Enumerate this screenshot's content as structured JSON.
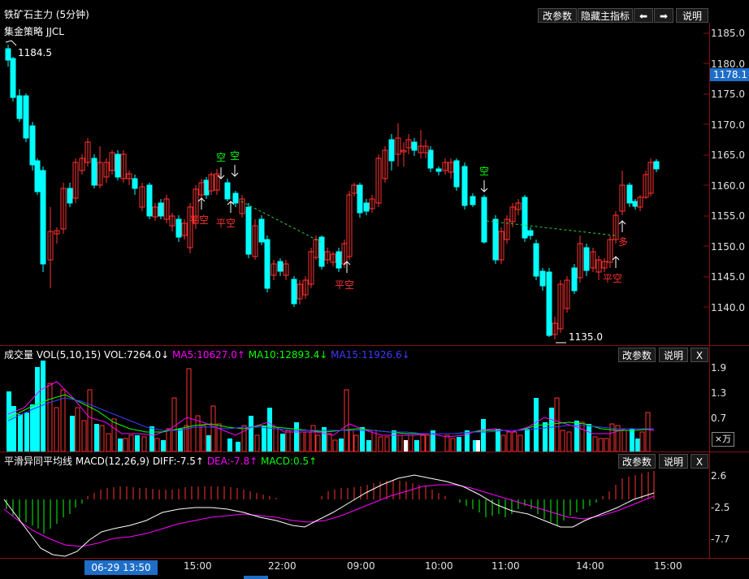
{
  "main_panel": {
    "title": "铁矿石主力 (5分钟)",
    "strategy": "集金策略 JJCL",
    "buttons": {
      "params": "改参数",
      "hide": "隐藏主指标",
      "left": "⬅",
      "right": "➡",
      "help": "说明"
    },
    "price_axis": [
      "1185.0",
      "1180.0",
      "1175.0",
      "1170.0",
      "1165.0",
      "1160.0",
      "1155.0",
      "1150.0",
      "1145.0",
      "1140.0"
    ],
    "current_price": "1178.1",
    "high_label": "1184.5",
    "low_label": "1135.0",
    "signals": {
      "kong1": "空",
      "kong2": "空",
      "kong3": "空",
      "pingkong": "平空",
      "duo": "多"
    }
  },
  "volume_panel": {
    "name": "成交量",
    "indicator": "VOL(5,10,15)",
    "vol": "VOL:7264.0↓",
    "ma5": "MA5:10627.0↑",
    "ma10": "MA10:12893.4↓",
    "ma15": "MA15:11926.6↓",
    "axis": [
      "1.9",
      "1.3",
      "0.7"
    ],
    "unit": "×万",
    "buttons": {
      "params": "改参数",
      "help": "说明",
      "close": "X"
    }
  },
  "macd_panel": {
    "name": "平滑异同平均线",
    "indicator": "MACD(12,26,9)",
    "diff": "DIFF:-7.5↑",
    "dea": "DEA:-7.8↑",
    "macd": "MACD:0.5↑",
    "axis": [
      "2.6",
      "-2.5",
      "-7.7"
    ],
    "buttons": {
      "params": "改参数",
      "help": "说明",
      "close": "X"
    }
  },
  "time_axis": {
    "cursor_label": "06-29 13:50",
    "labels": [
      "15:00",
      "22:00",
      "09:00",
      "10:00",
      "11:00",
      "14:00",
      "15:00"
    ]
  },
  "colors": {
    "up": "#ff3232",
    "down": "#00ffff",
    "ma5": "#ff00ff",
    "ma10": "#00ff00",
    "ma15": "#3232ff",
    "text": "#ffffff"
  }
}
